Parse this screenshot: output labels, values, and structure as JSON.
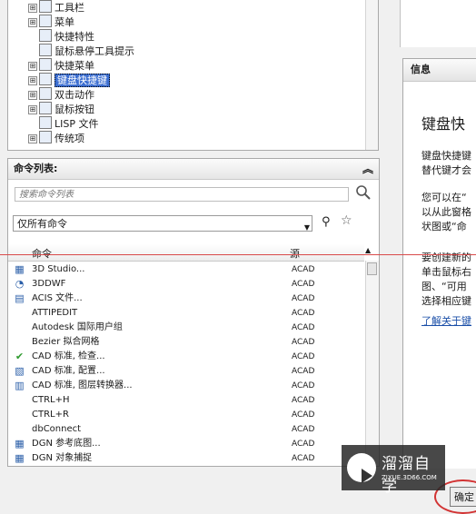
{
  "tree": {
    "items": [
      {
        "expander": "⊞",
        "label": "工具栏"
      },
      {
        "expander": "⊞",
        "label": "菜单"
      },
      {
        "expander": "",
        "label": "快捷特性"
      },
      {
        "expander": "",
        "label": "鼠标悬停工具提示"
      },
      {
        "expander": "⊞",
        "label": "快捷菜单"
      },
      {
        "expander": "⊞",
        "label": "键盘快捷键"
      },
      {
        "expander": "⊞",
        "label": "双击动作"
      },
      {
        "expander": "⊞",
        "label": "鼠标按钮"
      },
      {
        "expander": "",
        "label": "LISP 文件"
      },
      {
        "expander": "⊞",
        "label": "传统项"
      }
    ]
  },
  "info": {
    "header": "信息",
    "title": "键盘快",
    "lines": [
      "键盘快捷键",
      "替代键才会",
      "您可以在“",
      "以从此窗格",
      "状图或“命",
      "要创建新的",
      "单击鼠标右",
      "图、“可用",
      "选择相应键"
    ],
    "link": "了解关于键"
  },
  "cmd": {
    "header": "命令列表:",
    "collapse": "︽",
    "search_placeholder": "搜索命令列表",
    "filter": "仅所有命令",
    "columns": {
      "command": "命令",
      "source": "源"
    },
    "rows": [
      {
        "icon": "▦",
        "name": "3D Studio...",
        "source": "ACAD"
      },
      {
        "icon": "◔",
        "name": "3DDWF",
        "source": "ACAD"
      },
      {
        "icon": "▤",
        "name": "ACIS 文件...",
        "source": "ACAD"
      },
      {
        "icon": "",
        "name": "ATTIPEDIT",
        "source": "ACAD"
      },
      {
        "icon": "",
        "name": "Autodesk 国际用户组",
        "source": "ACAD"
      },
      {
        "icon": "",
        "name": "Bezier 拟合网格",
        "source": "ACAD"
      },
      {
        "icon": "✔",
        "name": "CAD 标准, 检查...",
        "source": "ACAD"
      },
      {
        "icon": "▧",
        "name": "CAD 标准, 配置...",
        "source": "ACAD"
      },
      {
        "icon": "▥",
        "name": "CAD 标准, 图层转换器...",
        "source": "ACAD"
      },
      {
        "icon": "",
        "name": "CTRL+H",
        "source": "ACAD"
      },
      {
        "icon": "",
        "name": "CTRL+R",
        "source": "ACAD"
      },
      {
        "icon": "",
        "name": "dbConnect",
        "source": "ACAD"
      },
      {
        "icon": "▦",
        "name": "DGN 参考底图...",
        "source": "ACAD"
      },
      {
        "icon": "▦",
        "name": "DGN 对象捕捉",
        "source": "ACAD"
      }
    ]
  },
  "ok_button": "确定",
  "watermark": {
    "name": "溜溜自学",
    "url": "ZIXUE.3D66.COM"
  }
}
